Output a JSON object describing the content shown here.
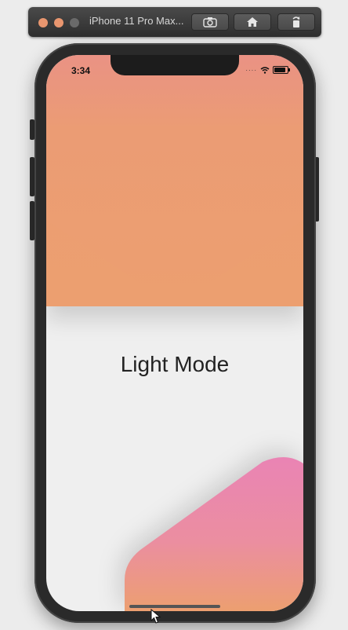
{
  "toolbar": {
    "title": "iPhone 11 Pro Max...",
    "buttons": [
      {
        "icon": "camera-icon"
      },
      {
        "icon": "home-icon"
      },
      {
        "icon": "rotate-icon"
      }
    ]
  },
  "status_bar": {
    "time": "3:34",
    "icons": [
      "cellular-dots-icon",
      "wifi-icon",
      "battery-icon"
    ]
  },
  "screen": {
    "title": "Light Mode"
  },
  "colors": {
    "top_shape": "#ec9f70",
    "bottom_shape_top": "#ea84b4",
    "bottom_shape_bottom": "#ec9f70",
    "background": "#efefef"
  }
}
